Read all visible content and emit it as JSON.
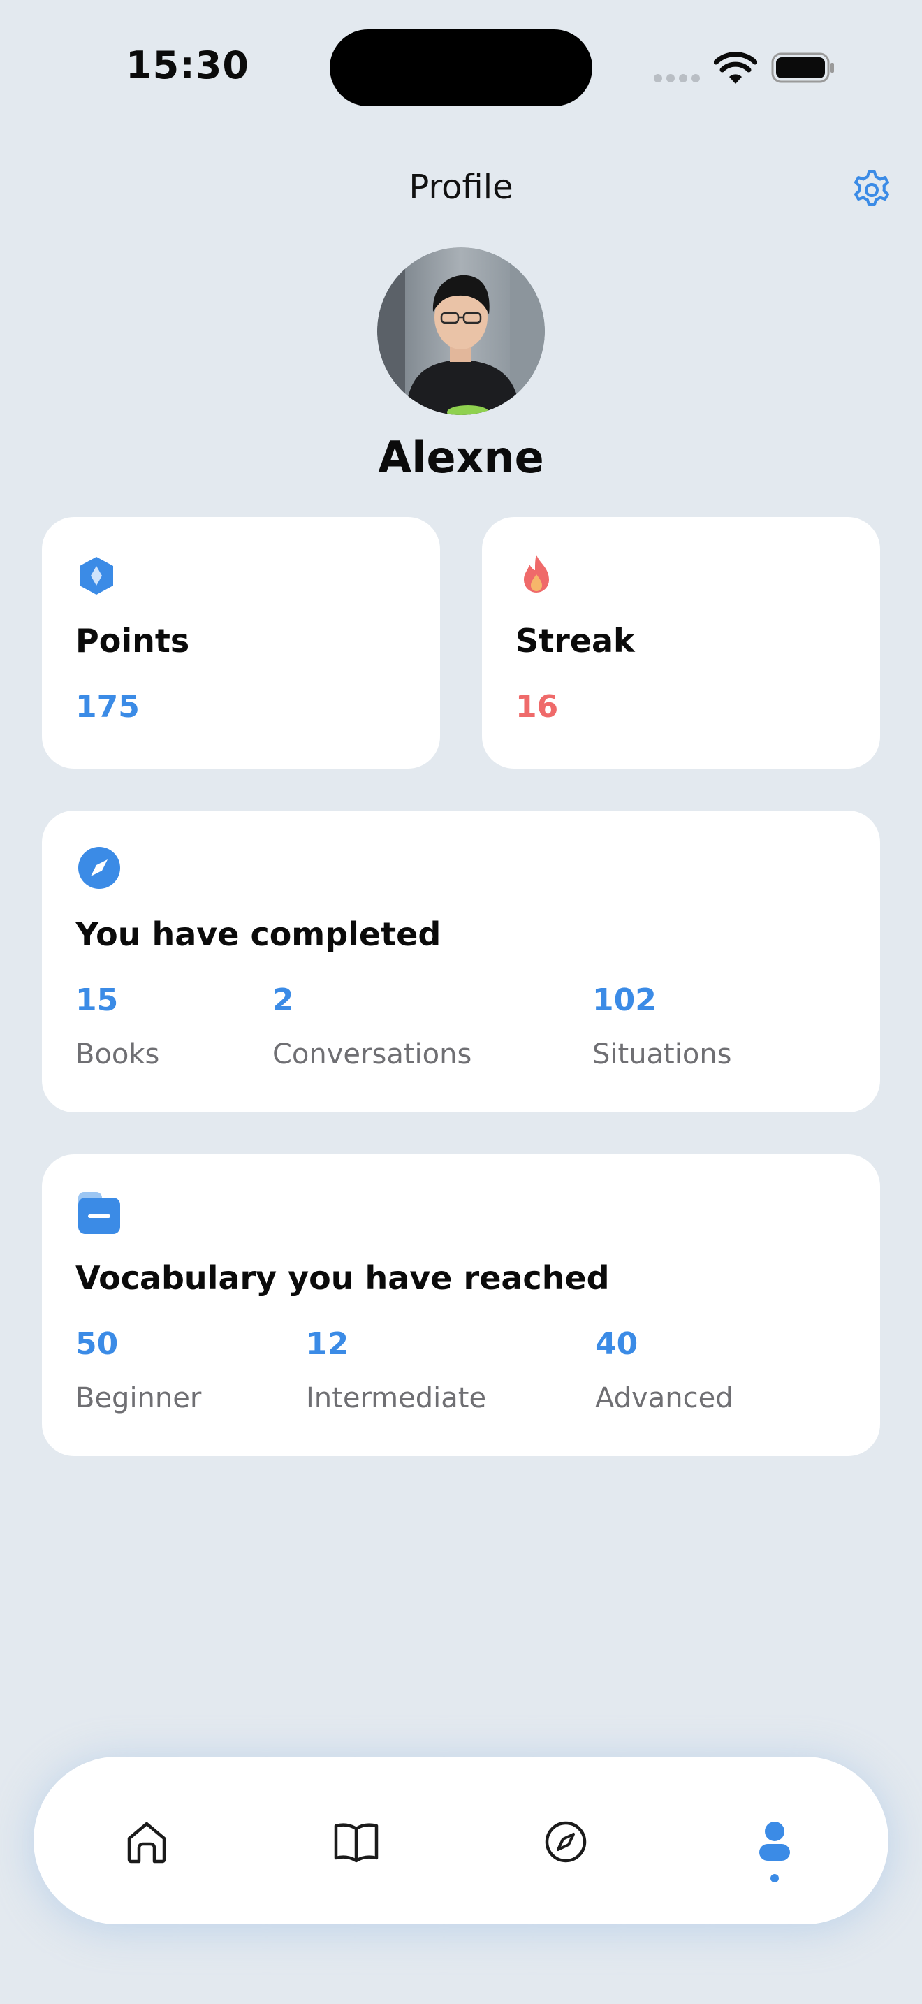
{
  "status_bar": {
    "time": "15:30"
  },
  "header": {
    "title": "Profile"
  },
  "user": {
    "name": "Alexne"
  },
  "points": {
    "label": "Points",
    "value": "175"
  },
  "streak": {
    "label": "Streak",
    "value": "16"
  },
  "completed": {
    "title": "You have completed",
    "stats": [
      {
        "value": "15",
        "label": "Books"
      },
      {
        "value": "2",
        "label": "Conversations"
      },
      {
        "value": "102",
        "label": "Situations"
      }
    ]
  },
  "vocabulary": {
    "title": "Vocabulary you have reached",
    "stats": [
      {
        "value": "50",
        "label": "Beginner"
      },
      {
        "value": "12",
        "label": "Intermediate"
      },
      {
        "value": "40",
        "label": "Advanced"
      }
    ]
  },
  "nav": {
    "items": [
      {
        "icon": "home-icon"
      },
      {
        "icon": "book-icon"
      },
      {
        "icon": "compass-icon"
      },
      {
        "icon": "profile-icon",
        "active": true
      }
    ]
  },
  "colors": {
    "accent": "#3b8be6",
    "streak": "#ef6a6a",
    "background": "#e3e9ef"
  }
}
